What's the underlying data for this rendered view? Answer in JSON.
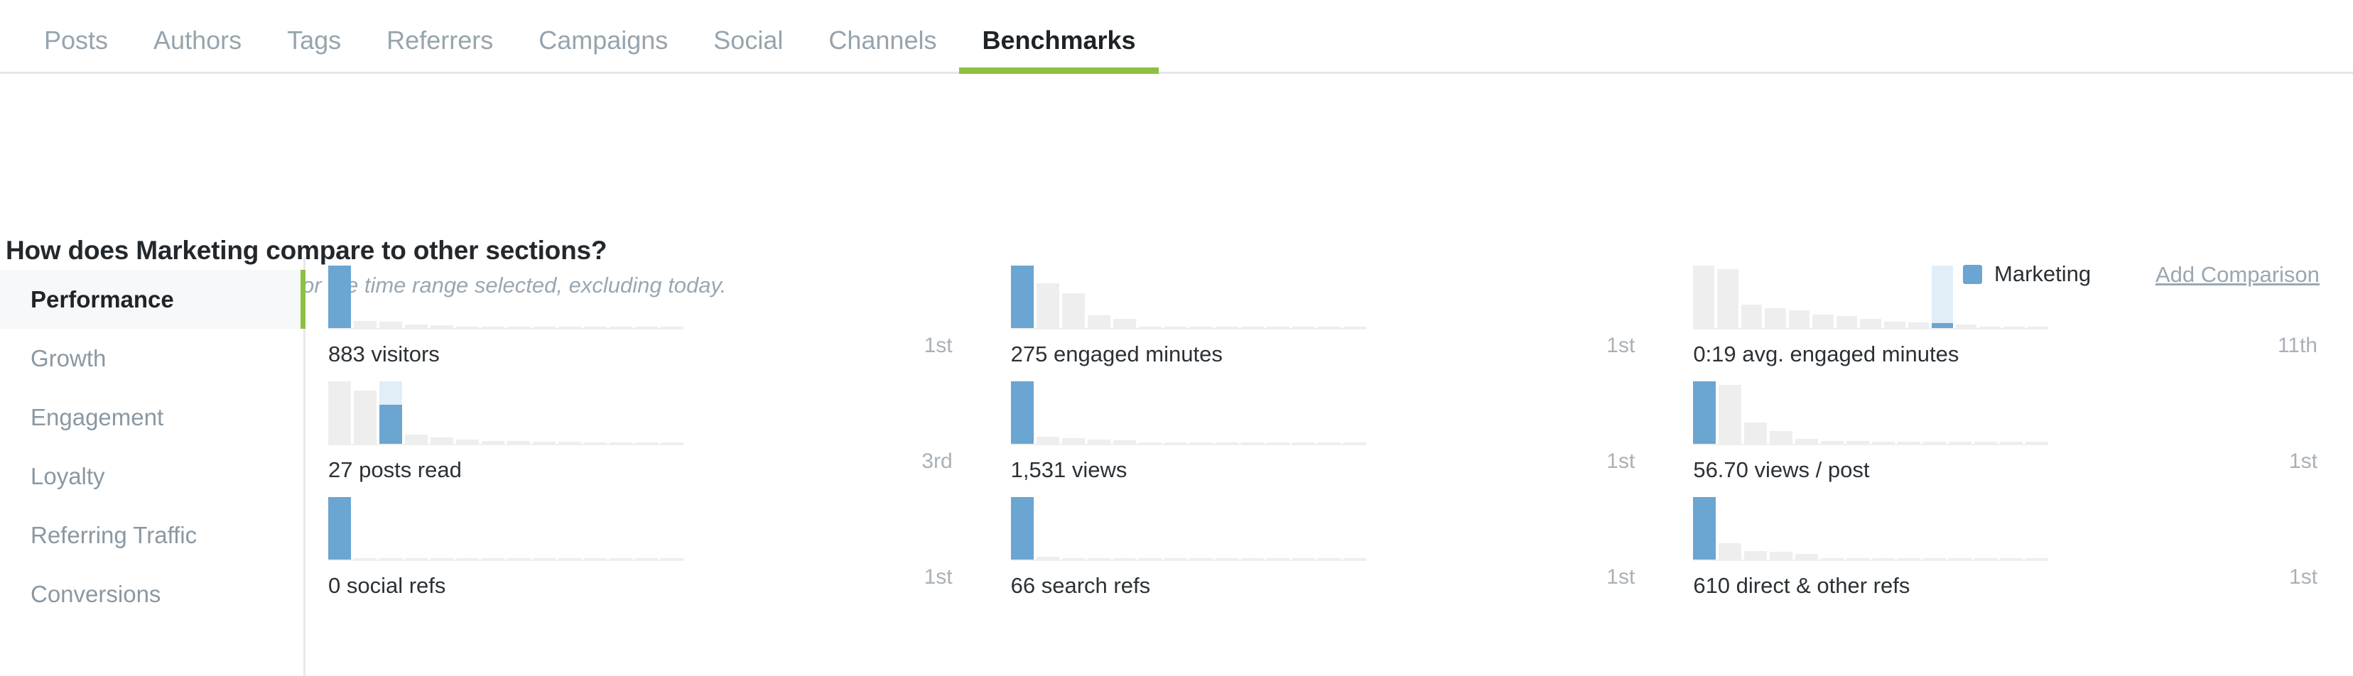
{
  "tabs": [
    {
      "label": "Posts",
      "active": false
    },
    {
      "label": "Authors",
      "active": false
    },
    {
      "label": "Tags",
      "active": false
    },
    {
      "label": "Referrers",
      "active": false
    },
    {
      "label": "Campaigns",
      "active": false
    },
    {
      "label": "Social",
      "active": false
    },
    {
      "label": "Channels",
      "active": false
    },
    {
      "label": "Benchmarks",
      "active": true
    }
  ],
  "header": {
    "title": "How does Marketing compare to other sections?",
    "subtitle": "Note: the data shows metrics for the time range selected, excluding today.",
    "legend_label": "Marketing",
    "legend_color": "#6ba5d1",
    "add_comparison_label": "Add Comparison"
  },
  "sidebar": {
    "items": [
      {
        "label": "Performance",
        "active": true
      },
      {
        "label": "Growth",
        "active": false
      },
      {
        "label": "Engagement",
        "active": false
      },
      {
        "label": "Loyalty",
        "active": false
      },
      {
        "label": "Referring Traffic",
        "active": false
      },
      {
        "label": "Conversions",
        "active": false
      }
    ],
    "accent_color": "#8dbf43"
  },
  "chart_data": {
    "type": "bar",
    "title": "How does Marketing compare to other sections?",
    "subtitle": "Note: the data shows metrics for the time range selected, excluding today.",
    "legend": [
      "Marketing"
    ],
    "legend_position": "top-right",
    "grid": false,
    "xlabel": "",
    "ylabel": "",
    "highlight_color": "#6ba5d1",
    "other_color": "#eeeeee",
    "highlight_bg_color": "#e1eef8",
    "panels": [
      {
        "label": "883 visitors",
        "value": 883,
        "metric": "visitors",
        "rank": "1st",
        "highlight_index": 0,
        "values": [
          100,
          11,
          10,
          6,
          5,
          2,
          2,
          2,
          2,
          2,
          2,
          2,
          2,
          2
        ]
      },
      {
        "label": "275 engaged minutes",
        "value": 275,
        "metric": "engaged minutes",
        "rank": "1st",
        "highlight_index": 0,
        "values": [
          100,
          72,
          56,
          20,
          15,
          2,
          2,
          2,
          2,
          2,
          2,
          2,
          2,
          2
        ]
      },
      {
        "label": "0:19 avg. engaged minutes",
        "value": "0:19",
        "metric": "avg. engaged minutes",
        "rank": "11th",
        "highlight_index": 10,
        "values": [
          100,
          94,
          38,
          32,
          28,
          22,
          19,
          15,
          10,
          9,
          8,
          6,
          2,
          2,
          2
        ]
      },
      {
        "label": "27 posts read",
        "value": 27,
        "metric": "posts read",
        "rank": "3rd",
        "highlight_index": 2,
        "values": [
          100,
          85,
          62,
          15,
          10,
          7,
          5,
          4,
          3,
          3,
          2,
          2,
          2,
          2
        ]
      },
      {
        "label": "1,531 views",
        "value": 1531,
        "metric": "views",
        "rank": "1st",
        "highlight_index": 0,
        "values": [
          100,
          11,
          9,
          7,
          6,
          2,
          2,
          2,
          2,
          2,
          2,
          2,
          2,
          2
        ]
      },
      {
        "label": "56.70 views / post",
        "value": 56.7,
        "metric": "views / post",
        "rank": "1st",
        "highlight_index": 0,
        "values": [
          100,
          94,
          34,
          20,
          8,
          5,
          5,
          3,
          3,
          3,
          3,
          3,
          3,
          3
        ]
      },
      {
        "label": "0 social refs",
        "value": 0,
        "metric": "social refs",
        "rank": "1st",
        "highlight_index": 0,
        "values": [
          100,
          2,
          2,
          2,
          2,
          2,
          2,
          2,
          2,
          2,
          2,
          2,
          2,
          2
        ]
      },
      {
        "label": "66 search refs",
        "value": 66,
        "metric": "search refs",
        "rank": "1st",
        "highlight_index": 0,
        "values": [
          100,
          5,
          2,
          2,
          2,
          2,
          2,
          2,
          2,
          2,
          2,
          2,
          2,
          2
        ]
      },
      {
        "label": "610 direct & other refs",
        "value": 610,
        "metric": "direct & other refs",
        "rank": "1st",
        "highlight_index": 0,
        "values": [
          100,
          26,
          14,
          13,
          9,
          2,
          2,
          2,
          2,
          2,
          2,
          2,
          2,
          2
        ]
      }
    ]
  }
}
